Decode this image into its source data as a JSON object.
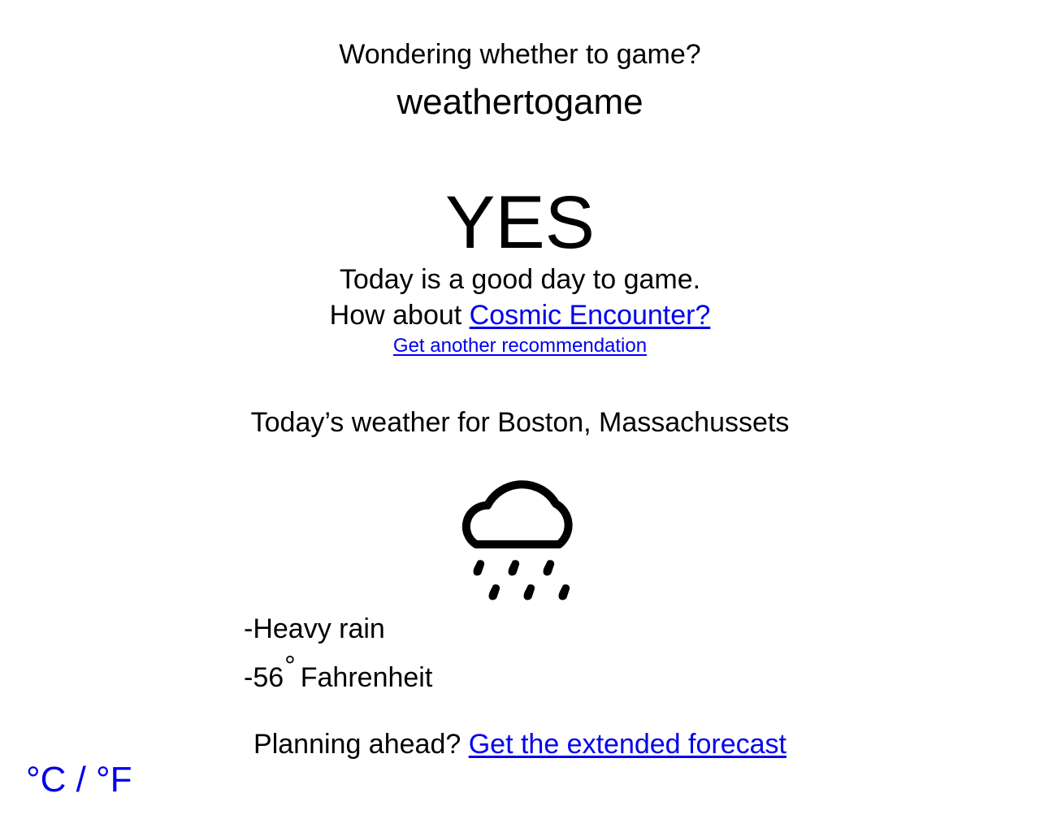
{
  "header": {
    "tagline": "Wondering whether to game?",
    "brand": "weathertogame"
  },
  "verdict": {
    "answer": "YES",
    "message": "Today is a good day to game.",
    "suggest_prefix": "How about ",
    "game_link": "Cosmic Encounter?",
    "another_link": "Get another recommendation"
  },
  "weather": {
    "location_label": "Today’s weather for Boston, Massachussets",
    "icon": "heavy-rain-icon",
    "condition": "-Heavy rain",
    "temperature_value": "-56",
    "degree_symbol": "°",
    "temperature_unit": "Fahrenheit"
  },
  "footer": {
    "planning_prefix": "Planning ahead? ",
    "forecast_link": "Get the extended forecast"
  },
  "unit_toggle": {
    "label": "°C / °F"
  },
  "colors": {
    "link": "#0000ee",
    "text": "#000000",
    "background": "#ffffff"
  }
}
